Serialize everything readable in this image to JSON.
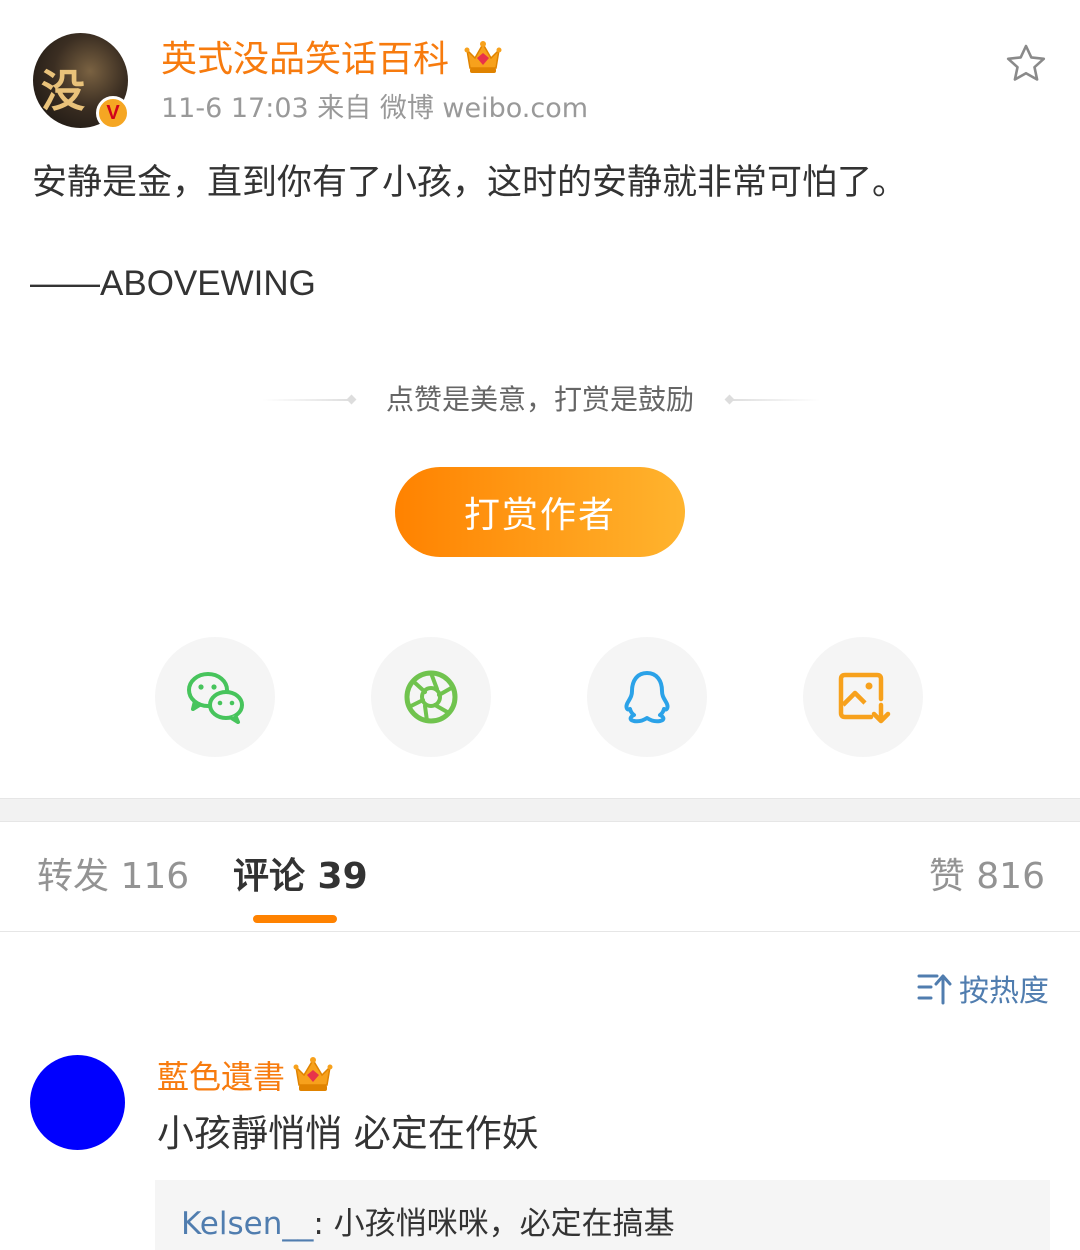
{
  "post": {
    "author": "英式没品笑话百科",
    "avatar_text": "没",
    "verified_badge": "V",
    "meta": "11-6 17:03  来自 微博 weibo.com",
    "text": "安静是金，直到你有了小孩，这时的安静就非常可怕了。",
    "signature": "——ABOVEWING"
  },
  "reward": {
    "hint": "点赞是美意，打赏是鼓励",
    "button_label": "打赏作者"
  },
  "share_icons": [
    "wechat-icon",
    "moments-icon",
    "qq-icon",
    "save-image-icon"
  ],
  "tabs": {
    "repost": "转发 116",
    "comments": "评论 39",
    "likes": "赞 816"
  },
  "sort_label": "按热度",
  "comment": {
    "user": "藍色遺書",
    "text": "小孩靜悄悄 必定在作妖",
    "reply_user": "Kelsen__",
    "reply_text": ": 小孩悄咪咪，必定在搞基"
  },
  "colors": {
    "accent_orange": "#ff8200",
    "name_orange": "#f77b0e",
    "link_blue": "#507daf",
    "wechat_green": "#47c45c",
    "moments_green": "#70c34e",
    "qq_blue": "#2ba2e8",
    "save_orange": "#f7a11c"
  }
}
